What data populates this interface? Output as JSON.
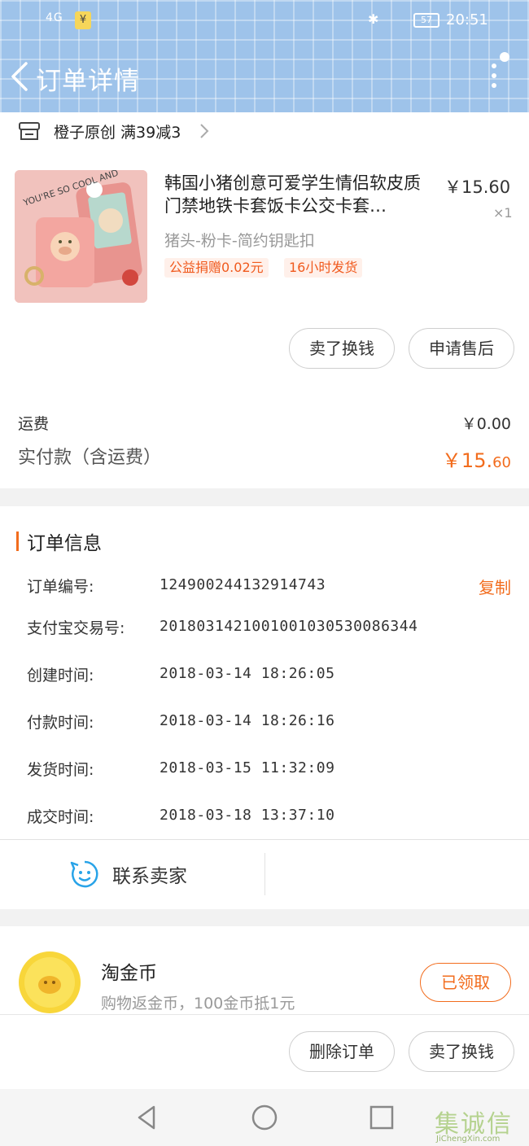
{
  "status_bar": {
    "signal": "4G",
    "time": "20:51",
    "battery": "57"
  },
  "header": {
    "title": "订单详情"
  },
  "shop": {
    "name": "橙子原创 满39减3"
  },
  "product": {
    "title": "韩国小猪创意可爱学生情侣软皮质门禁地铁卡套饭卡公交卡套…",
    "price": "￥15.60",
    "qty": "×1",
    "sku": "猪头-粉卡-简约钥匙扣",
    "tags": [
      "公益捐赠0.02元",
      "16小时发货"
    ],
    "image_text": "YOU'RE SO COOL AND"
  },
  "actions_item": {
    "sell": "卖了换钱",
    "after_sale": "申请售后"
  },
  "payment": {
    "shipping_label": "运费",
    "shipping_value": "￥0.00",
    "total_label": "实付款（含运费）",
    "total_int": "￥15.",
    "total_dec": "60"
  },
  "order_info": {
    "heading": "订单信息",
    "copy_label": "复制",
    "rows": [
      {
        "label": "订单编号:",
        "value": "124900244132914743"
      },
      {
        "label": "支付宝交易号:",
        "value": "2018031421001001030530086344"
      },
      {
        "label": "创建时间:",
        "value": "2018-03-14 18:26:05"
      },
      {
        "label": "付款时间:",
        "value": "2018-03-14 18:26:16"
      },
      {
        "label": "发货时间:",
        "value": "2018-03-15 11:32:09"
      },
      {
        "label": "成交时间:",
        "value": "2018-03-18 13:37:10"
      }
    ]
  },
  "contact": {
    "label": "联系卖家"
  },
  "coin": {
    "title": "淘金币",
    "subtitle": "购物返金币，100金币抵1元",
    "button": "已领取"
  },
  "bottom_actions": {
    "delete": "删除订单",
    "sell": "卖了换钱"
  },
  "watermark": {
    "text": "集诚信",
    "url": "JiChengXin.com"
  },
  "colors": {
    "accent": "#f26c1d",
    "header": "#9ec3ea"
  }
}
